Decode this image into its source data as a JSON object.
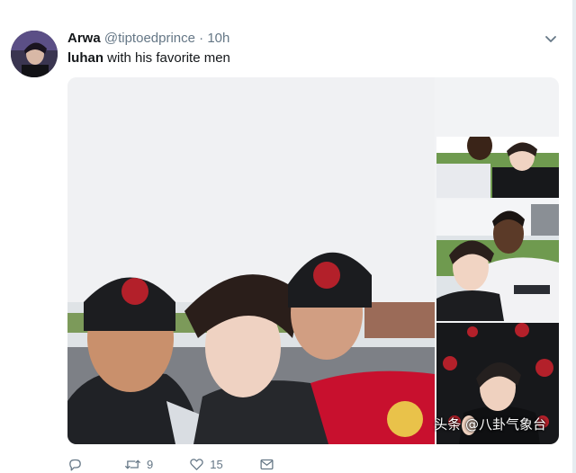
{
  "tweet": {
    "display_name": "Arwa",
    "handle": "@tiptoedprince",
    "separator": "·",
    "time": "10h",
    "text_bold": "luhan",
    "text_rest": " with his favorite men"
  },
  "actions": {
    "reply_count": "",
    "retweet_count": "9",
    "like_count": "15"
  },
  "watermark": "头条 @八卦气象台",
  "icons": {
    "menu": "chevron-down-icon",
    "reply": "reply-icon",
    "retweet": "retweet-icon",
    "like": "heart-icon",
    "message": "message-icon"
  },
  "colors": {
    "secondary_text": "#657786",
    "text": "#14171a",
    "red_kit": "#c8102e"
  }
}
